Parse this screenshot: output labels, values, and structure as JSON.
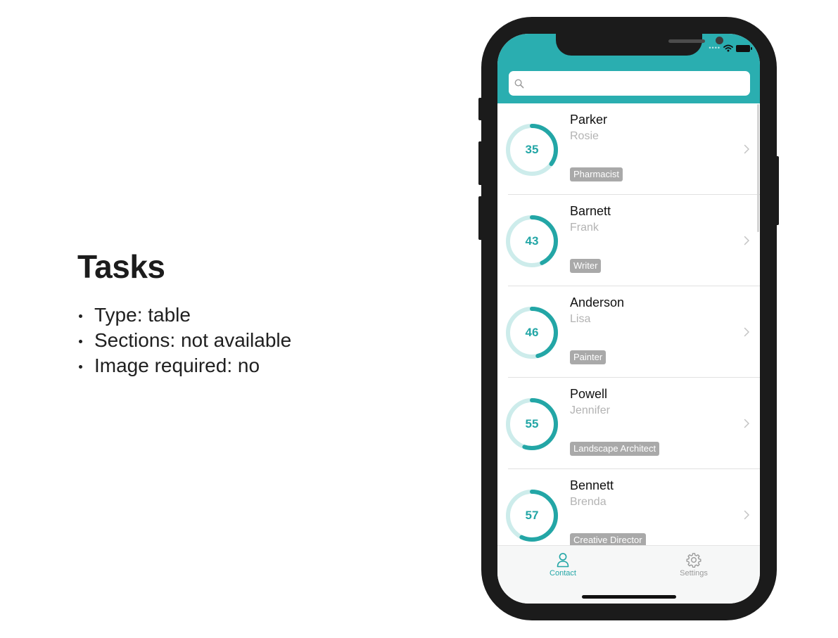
{
  "description": {
    "title": "Tasks",
    "items": [
      "Type: table",
      "Sections: not available",
      "Image required: no"
    ]
  },
  "search": {
    "placeholder": ""
  },
  "contacts": [
    {
      "last": "Parker",
      "first": "Rosie",
      "job": "Pharmacist",
      "score": "35",
      "progress": 0.35
    },
    {
      "last": "Barnett",
      "first": "Frank",
      "job": "Writer",
      "score": "43",
      "progress": 0.43
    },
    {
      "last": "Anderson",
      "first": "Lisa",
      "job": "Painter",
      "score": "46",
      "progress": 0.46
    },
    {
      "last": "Powell",
      "first": "Jennifer",
      "job": "Landscape Architect",
      "score": "55",
      "progress": 0.55
    },
    {
      "last": "Bennett",
      "first": "Brenda",
      "job": "Creative Director",
      "score": "57",
      "progress": 0.57
    }
  ],
  "tabs": {
    "contact": "Contact",
    "settings": "Settings"
  },
  "colors": {
    "accent": "#2aaeb0",
    "ring_track": "#cdeceb",
    "ring_fill": "#23a6a6",
    "tag_bg": "#a9a9a9",
    "tab_active": "#23a6a6",
    "tab_inactive": "#9a9a9a"
  },
  "icons": {
    "search": "search-icon",
    "contact_tab": "person-icon",
    "settings_tab": "gear-icon",
    "row_disclosure": "chevron-right-icon",
    "wifi": "wifi-icon",
    "battery": "battery-icon"
  }
}
